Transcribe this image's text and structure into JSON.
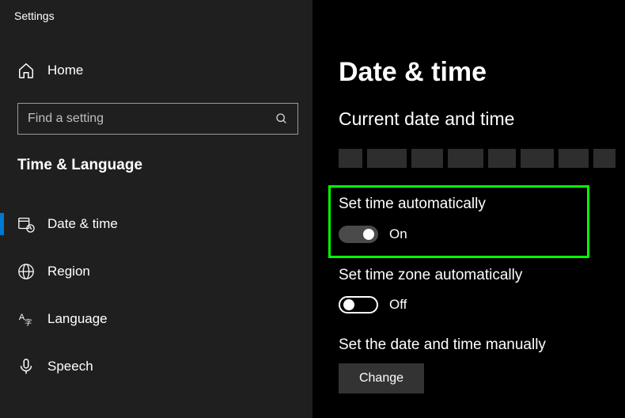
{
  "window_title": "Settings",
  "sidebar": {
    "home_label": "Home",
    "search_placeholder": "Find a setting",
    "section_title": "Time & Language",
    "items": [
      {
        "label": "Date & time",
        "selected": true
      },
      {
        "label": "Region",
        "selected": false
      },
      {
        "label": "Language",
        "selected": false
      },
      {
        "label": "Speech",
        "selected": false
      }
    ]
  },
  "main": {
    "title": "Date & time",
    "subtitle": "Current date and time",
    "set_time_auto": {
      "label": "Set time automatically",
      "state": "On",
      "on": true
    },
    "set_zone_auto": {
      "label": "Set time zone automatically",
      "state": "Off",
      "on": false
    },
    "manual": {
      "label": "Set the date and time manually",
      "button": "Change"
    }
  }
}
